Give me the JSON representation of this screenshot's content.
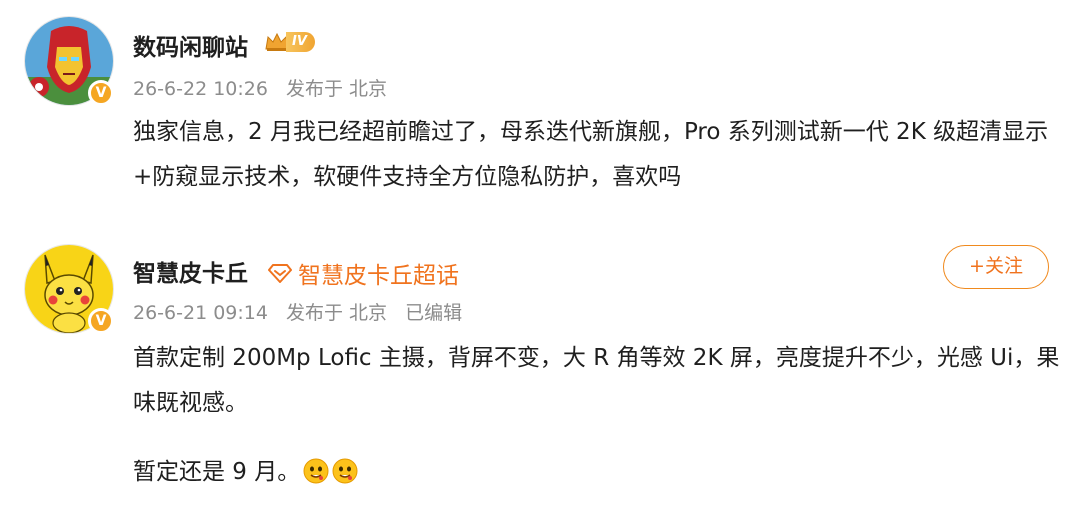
{
  "posts": [
    {
      "username": "数码闲聊站",
      "rank_badge": "IV",
      "timestamp": "26-6-22 10:26",
      "source": "发布于 北京",
      "content": "独家信息，2 月我已经超前瞻过了，母系迭代新旗舰，Pro 系列测试新一代 2K 级超清显示+防窥显示技术，软硬件支持全方位隐私防护，喜欢吗"
    },
    {
      "username": "智慧皮卡丘",
      "topic": "智慧皮卡丘超话",
      "follow_label": "+关注",
      "timestamp": "26-6-21 09:14",
      "source": "发布于 北京",
      "edited": "已编辑",
      "content_paragraph_1": "首款定制 200Mp Lofic 主摄，背屏不变，大 R 角等效 2K 屏，亮度提升不少，光感 Ui，果味既视感。",
      "content_paragraph_2": "暂定还是 9 月。",
      "emojis": [
        "drooling-face-emoji",
        "drooling-face-emoji"
      ]
    }
  ],
  "colors": {
    "accent_orange": "#f0731e",
    "verified_badge": "#f5a623",
    "meta_gray": "#8c8c8c",
    "text": "#1f1f1f"
  }
}
